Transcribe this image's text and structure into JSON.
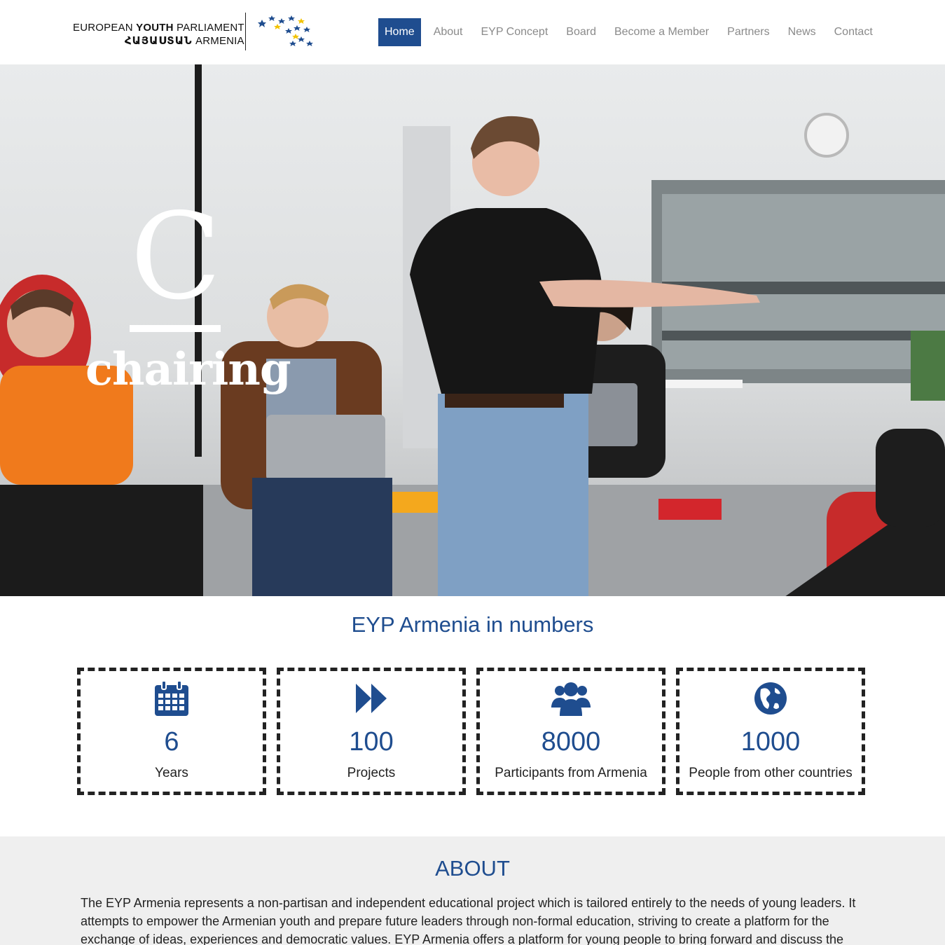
{
  "header": {
    "logo": {
      "line1_pre": "EUROPEAN ",
      "line1_bold": "YOUTH",
      "line1_post": " PARLIAMENT",
      "line2_bold": "ՀԱՅԱՍՏԱՆ",
      "line2_post": " ARMENIA"
    },
    "nav": [
      {
        "label": "Home",
        "active": true
      },
      {
        "label": "About"
      },
      {
        "label": "EYP Concept"
      },
      {
        "label": "Board"
      },
      {
        "label": "Become a Member"
      },
      {
        "label": "Partners"
      },
      {
        "label": "News"
      },
      {
        "label": "Contact"
      }
    ]
  },
  "hero": {
    "letter": "C",
    "word": "chairing"
  },
  "numbers": {
    "title": "EYP Armenia in numbers",
    "stats": [
      {
        "icon": "calendar-icon",
        "value": "6",
        "label": "Years"
      },
      {
        "icon": "fast-forward-icon",
        "value": "100",
        "label": "Projects"
      },
      {
        "icon": "users-icon",
        "value": "8000",
        "label": "Participants from Armenia"
      },
      {
        "icon": "globe-icon",
        "value": "1000",
        "label": "People from other countries"
      }
    ]
  },
  "about": {
    "title": "ABOUT",
    "text": "The EYP Armenia represents a non-partisan and independent educational project which is tailored entirely to the needs of young leaders. It attempts to empower the Armenian youth and prepare future leaders through non-formal education, striving to create a platform for the exchange of ideas, experiences and democratic values. EYP Armenia offers a platform for young people to bring forward and discuss the socio-"
  },
  "colors": {
    "brand_blue": "#1f4d8f",
    "nav_text": "#8a8a8a",
    "about_bg": "#efefef"
  }
}
